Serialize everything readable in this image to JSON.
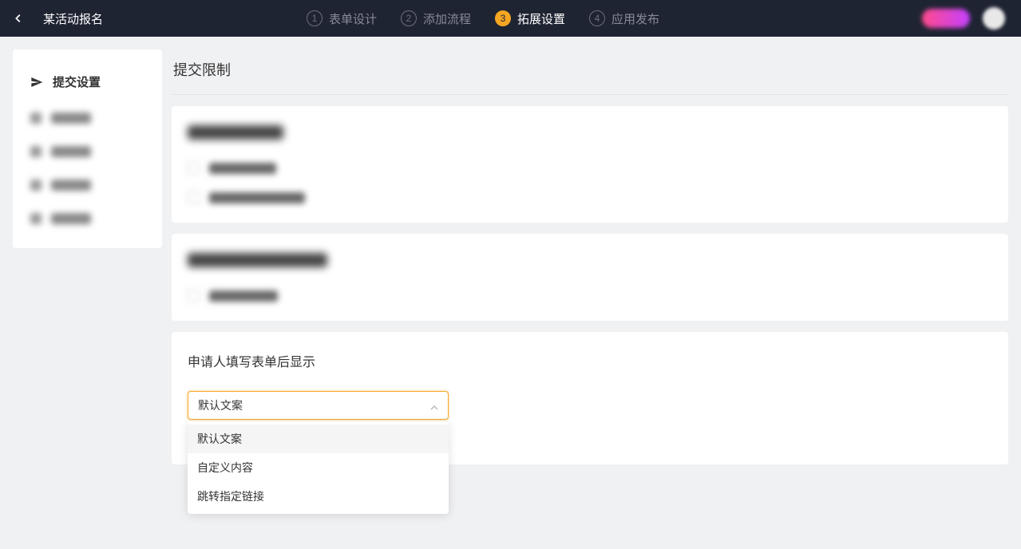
{
  "header": {
    "title": "某活动报名",
    "steps": [
      {
        "number": "1",
        "label": "表单设计",
        "active": false
      },
      {
        "number": "2",
        "label": "添加流程",
        "active": false
      },
      {
        "number": "3",
        "label": "拓展设置",
        "active": true
      },
      {
        "number": "4",
        "label": "应用发布",
        "active": false
      }
    ]
  },
  "sidebar": {
    "active_item": {
      "label": "提交设置"
    }
  },
  "main": {
    "section_title": "提交限制",
    "card3": {
      "heading": "申请人填写表单后显示",
      "select": {
        "value": "默认文案",
        "options": [
          "默认文案",
          "自定义内容",
          "跳转指定链接"
        ]
      }
    }
  }
}
